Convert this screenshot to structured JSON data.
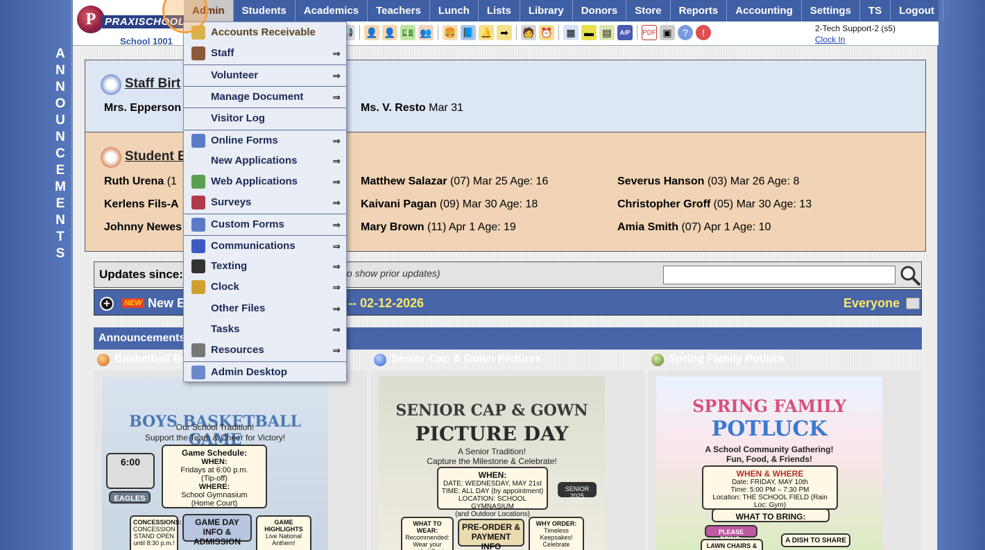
{
  "side_label": [
    "A",
    "N",
    "N",
    "O",
    "U",
    "N",
    "C",
    "E",
    "M",
    "E",
    "N",
    "T",
    "S"
  ],
  "logo": {
    "letter": "P",
    "text": "PRAXISCHOOL",
    "school": "School 1001"
  },
  "nav": [
    "Admin",
    "Students",
    "Academics",
    "Teachers",
    "Lunch",
    "Lists",
    "Library",
    "Donors",
    "Store",
    "Reports",
    "Accounting",
    "Settings",
    "TS",
    "Logout"
  ],
  "user": {
    "name": "2-Tech Support-2 (s5)",
    "clock": "Clock In"
  },
  "staff": {
    "title": "Staff Birt",
    "entries": [
      {
        "name": "Mrs. Epperson",
        "date": ""
      },
      {
        "name": "Ms. V. Resto",
        "date": "Mar 31"
      }
    ]
  },
  "student": {
    "title": "Student B",
    "entries": [
      {
        "name": "Ruth Urena",
        "rest": "(1"
      },
      {
        "name": "Kerlens Fils-A",
        "rest": ""
      },
      {
        "name": "Johnny Newes",
        "rest": ""
      },
      {
        "name": "Matthew Salazar",
        "rest": "(07) Mar 25 Age: 16"
      },
      {
        "name": "Kaivani Pagan",
        "rest": "(09) Mar 30 Age: 18"
      },
      {
        "name": "Mary Brown",
        "rest": "(11) Apr 1 Age: 19"
      },
      {
        "name": "Severus Hanson",
        "rest": "(03) Mar 26 Age: 8"
      },
      {
        "name": "Christopher Groff",
        "rest": "(05) Mar 30 Age: 13"
      },
      {
        "name": "Amia Smith",
        "rest": "(07) Apr 1 Age: 10"
      }
    ]
  },
  "updates": {
    "label": "Updates since:",
    "hint": "to show prior updates)",
    "search_placeholder": ""
  },
  "new_bar": {
    "badge": "NEW",
    "text": "New E",
    "date": "-- 02-12-2026",
    "audience": "Everyone"
  },
  "announcements": {
    "header": "Announcements",
    "cards": [
      {
        "title": "Basketball Be",
        "color": "#c8641e"
      },
      {
        "title": "Senior Cap & Gown Pictures",
        "color": "#3b6fc4"
      },
      {
        "title": "Spring Family Potluck",
        "color": "#5d7a2c"
      }
    ]
  },
  "posters": {
    "basketball": {
      "title": "BOYS BASKETBALL GAME",
      "sub1": "Our School Tradition!",
      "sub2": "Support the Team & Cheer for Victory!",
      "box_title": "Game Schedule:",
      "when": "WHEN:",
      "when_val": "Fridays at 6:00 p.m.",
      "tipoff": "(Tip-off)",
      "where": "WHERE:",
      "where_val": "School Gymnasium",
      "court": "(Home Court)",
      "conc": "CONCESSIONS:",
      "conc_val": "CONCESSION STAND OPEN until 8:30 p.m.!",
      "info": "GAME DAY INFO & ADMISSION",
      "highlights": "GAME HIGHLIGHTS",
      "anthem": "Live National Anthem!",
      "scoreboard": "6:00",
      "team": "EAGLES"
    },
    "senior": {
      "title1": "SENIOR CAP & GOWN",
      "title2": "PICTURE DAY",
      "sub1": "A Senior Tradition!",
      "sub2": "Capture the Milestone & Celebrate!",
      "when": "WHEN:",
      "date": "DATE: WEDNESDAY, MAY 21st",
      "time": "TIME: ALL DAY (by appointment)",
      "loc": "LOCATION: SCHOOL GYMNASIUM",
      "loc2": "(and Outdoor Locations)",
      "wear": "WHAT TO WEAR:",
      "wear_val": "Recommended: Wear your provided Senior Cap & Gown.",
      "preorder": "PRE-ORDER & PAYMENT INFO",
      "why": "WHY ORDER:",
      "why_val": "Timeless Keepsakes!",
      "celebrate": "Celebrate",
      "seal": "SENIOR 2025"
    },
    "potluck": {
      "title1": "SPRING FAMILY",
      "title2": "POTLUCK",
      "sub1": "A School Community Gathering!",
      "sub2": "Fun, Food, & Friends!",
      "when": "WHEN & WHERE",
      "date": "Date: FRIDAY, MAY 10th",
      "time": "Time: 5:00 PM – 7:30 PM",
      "loc": "Location: THE SCHOOL FIELD (Rain Loc: Gym)",
      "bring": "WHAT TO BRING:",
      "please": "PLEASE BRING:",
      "chairs": "LAWN CHAIRS & PICNIC BLANKETS",
      "dish": "A DISH TO SHARE"
    }
  },
  "menu": [
    {
      "label": "Accounts Receivable",
      "arrow": "",
      "icon": "money-icon",
      "color": "#d7b34c"
    },
    {
      "label": "Staff",
      "arrow": "⇒",
      "icon": "staff-icon",
      "color": "#8a5a3a"
    },
    {
      "label": "Volunteer",
      "arrow": "⇒",
      "icon": "",
      "color": ""
    },
    {
      "label": "Manage Document",
      "arrow": "⇒",
      "icon": "",
      "color": ""
    },
    {
      "label": "Visitor Log",
      "arrow": "",
      "icon": "",
      "color": ""
    },
    {
      "label": "Online Forms",
      "arrow": "⇒",
      "icon": "html-icon",
      "color": "#5a7cc8"
    },
    {
      "label": "New Applications",
      "arrow": "⇒",
      "icon": "",
      "color": ""
    },
    {
      "label": "Web Applications",
      "arrow": "⇒",
      "icon": "globe-icon",
      "color": "#5aa050"
    },
    {
      "label": "Surveys",
      "arrow": "⇒",
      "icon": "survey-icon",
      "color": "#b03a4a"
    },
    {
      "label": "Custom Forms",
      "arrow": "⇒",
      "icon": "html-icon",
      "color": "#5a7cc8"
    },
    {
      "label": "Communications",
      "arrow": "⇒",
      "icon": "at-icon",
      "color": "#3a5ac0"
    },
    {
      "label": "Texting",
      "arrow": "⇒",
      "icon": "phone-icon",
      "color": "#333"
    },
    {
      "label": "Clock",
      "arrow": "⇒",
      "icon": "clock-icon",
      "color": "#d0a030"
    },
    {
      "label": "Other Files",
      "arrow": "⇒",
      "icon": "",
      "color": ""
    },
    {
      "label": "Tasks",
      "arrow": "⇒",
      "icon": "",
      "color": ""
    },
    {
      "label": "Resources",
      "arrow": "⇒",
      "icon": "resources-icon",
      "color": "#777"
    },
    {
      "label": "Admin Desktop",
      "arrow": "",
      "icon": "desktop-icon",
      "color": "#6a8acb"
    }
  ],
  "colors": {
    "nav": "#3f5fa4",
    "staff_bg": "#dde6f3",
    "student_bg": "#f0d4b5",
    "accent_yellow": "#ffe96a"
  }
}
